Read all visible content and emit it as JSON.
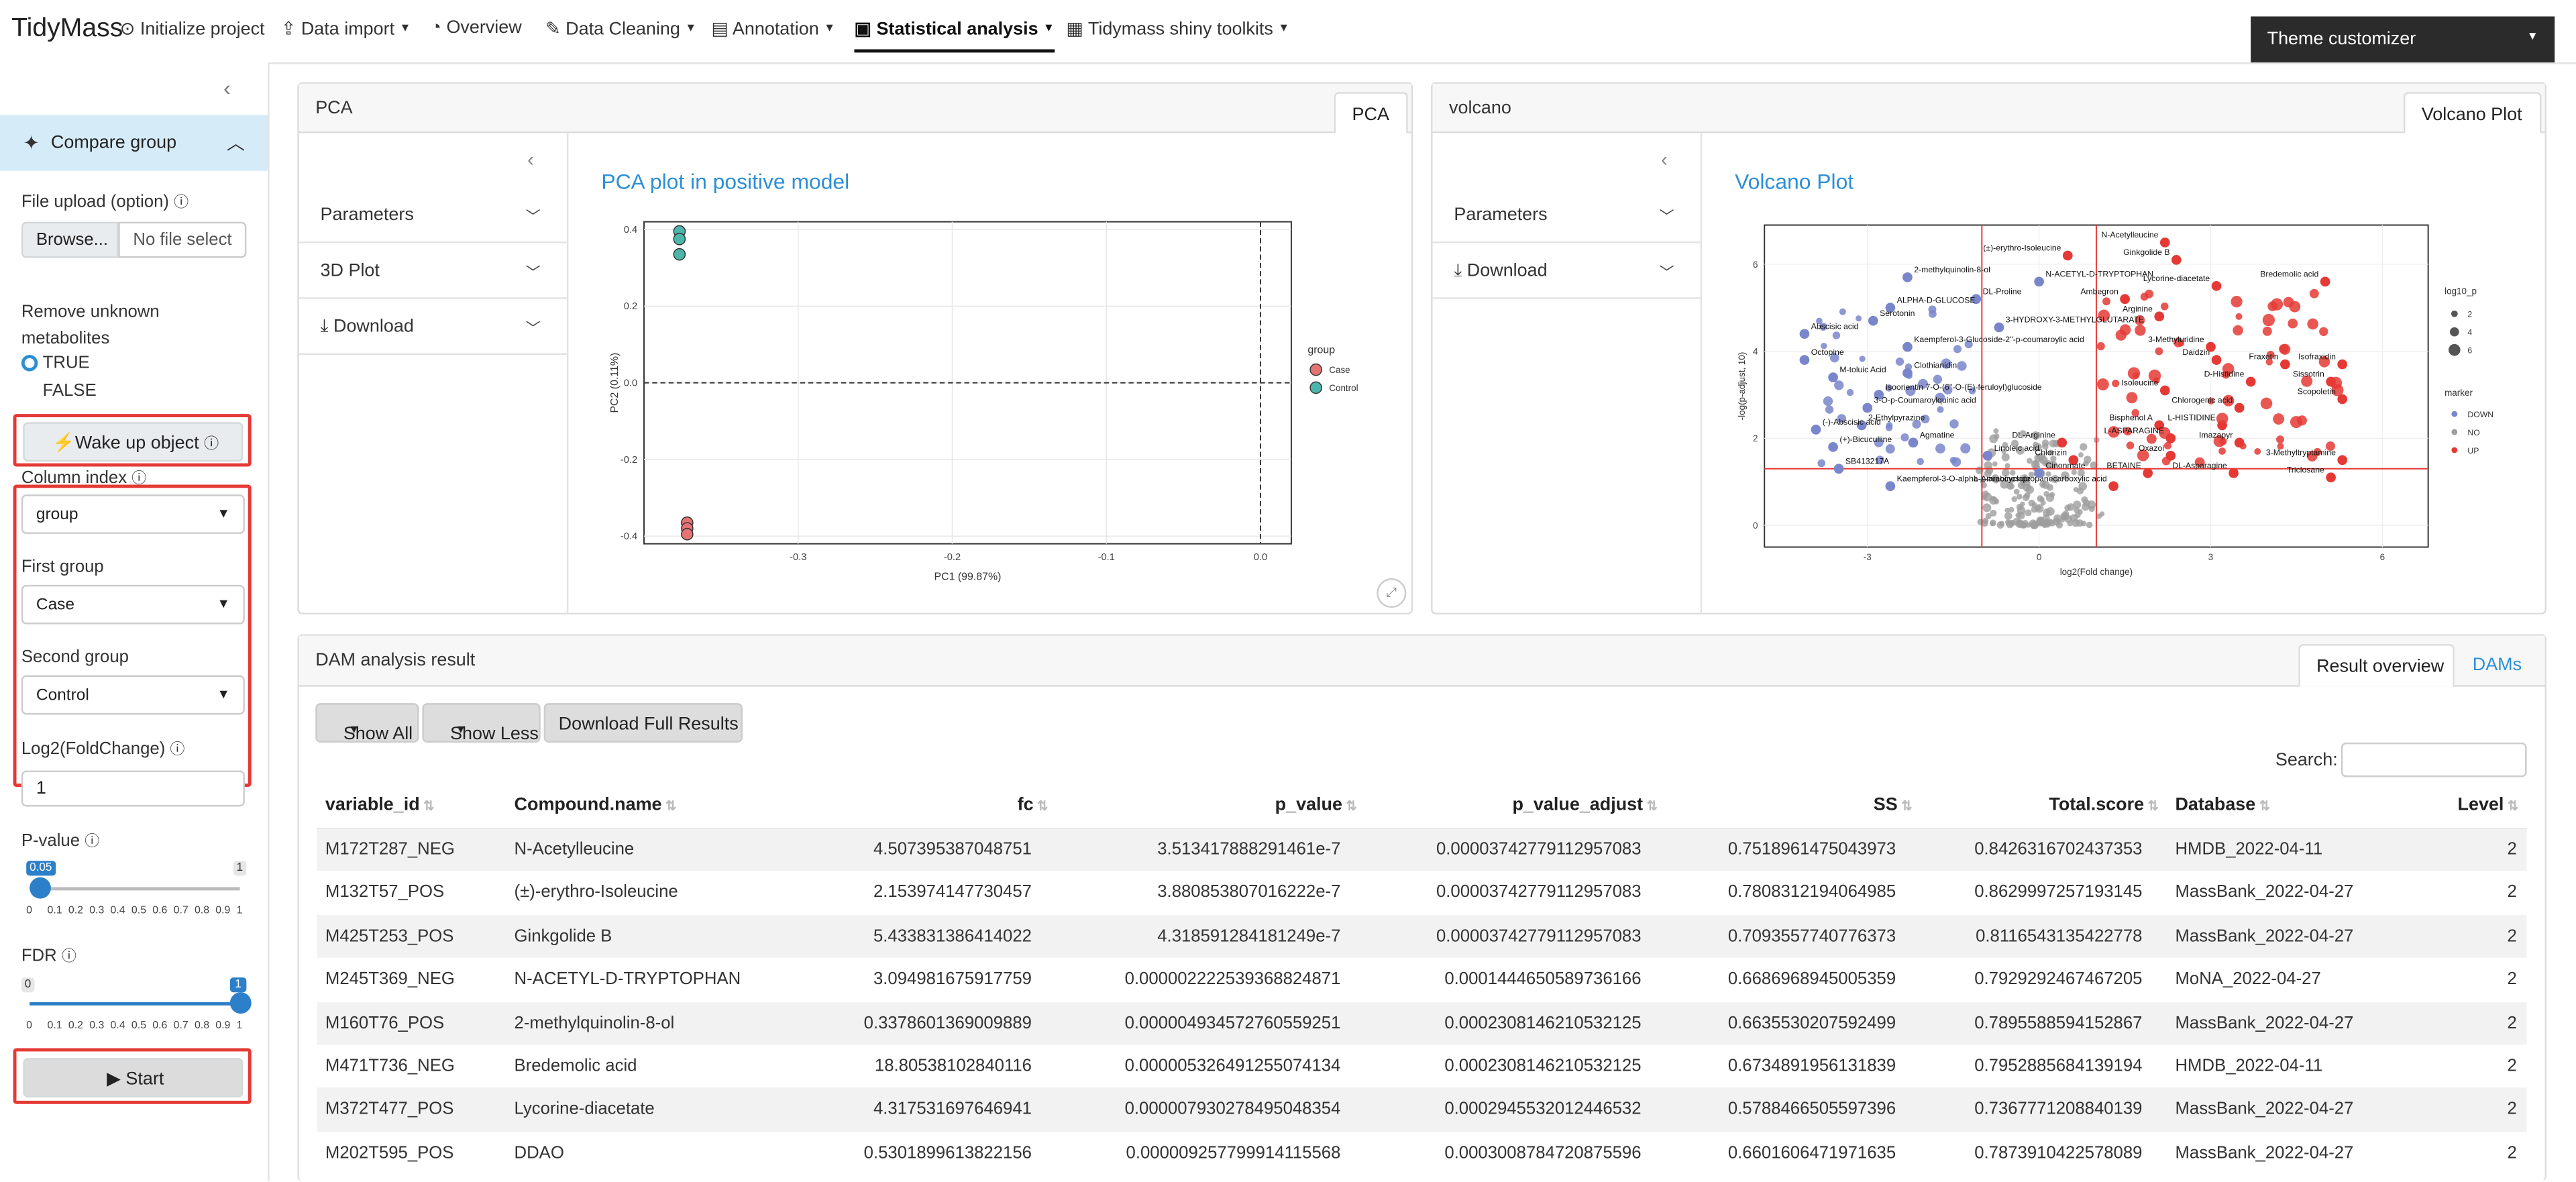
{
  "navbar": {
    "brand": "TidyMass",
    "items": [
      {
        "label": "Initialize project",
        "icon": "play-circle-icon"
      },
      {
        "label": "Data import",
        "icon": "upload-icon",
        "dropdown": true
      },
      {
        "label": "Overview",
        "icon": "gauge-icon"
      },
      {
        "label": "Data Cleaning",
        "icon": "broom-icon",
        "dropdown": true
      },
      {
        "label": "Annotation",
        "icon": "id-card-icon",
        "dropdown": true
      },
      {
        "label": "Statistical analysis",
        "icon": "chart-icon",
        "dropdown": true,
        "active": true
      },
      {
        "label": "Tidymass shiny toolkits",
        "icon": "toolbox-icon",
        "dropdown": true
      }
    ],
    "theme_button": "Theme customizer"
  },
  "sidebar": {
    "section_title": "Compare group",
    "file_upload_label": "File upload (option)",
    "browse_label": "Browse...",
    "file_placeholder": "No file select",
    "remove_unknown_label": "Remove unknown metabolites",
    "radio_true": "TRUE",
    "radio_false": "FALSE",
    "wake_up_label": "Wake up object",
    "column_index_label": "Column index",
    "column_index_value": "group",
    "first_group_label": "First group",
    "first_group_value": "Case",
    "second_group_label": "Second group",
    "second_group_value": "Control",
    "log2fc_label": "Log2(FoldChange)",
    "log2fc_value": "1",
    "pvalue_label": "P-value",
    "pvalue_value": 0.05,
    "pvalue_value_text": "0.05",
    "pvalue_max_text": "1",
    "fdr_label": "FDR",
    "fdr_value": 1,
    "fdr_value_text": "1",
    "fdr_min_text": "0",
    "slider_ticks": [
      "0",
      "0.1",
      "0.2",
      "0.3",
      "0.4",
      "0.5",
      "0.6",
      "0.7",
      "0.8",
      "0.9",
      "1"
    ],
    "start_label": "Start"
  },
  "pca_card": {
    "header": "PCA",
    "tab": "PCA",
    "accordion": [
      "Parameters",
      "3D Plot",
      "Download"
    ],
    "plot_title": "PCA plot in positive model"
  },
  "volcano_card": {
    "header": "volcano",
    "tab": "Volcano Plot",
    "accordion": [
      "Parameters",
      "Download"
    ],
    "plot_title": "Volcano Plot"
  },
  "chart_data": [
    {
      "type": "scatter",
      "title": "",
      "xlabel": "PC1 (99.87%)",
      "ylabel": "PC2 (0.11%)",
      "xlim": [
        -0.4,
        0.02
      ],
      "ylim": [
        -0.42,
        0.42
      ],
      "x_ticks": [
        "-0.3",
        "-0.2",
        "-0.1",
        "0.0"
      ],
      "y_ticks": [
        "0.4",
        "0.2",
        "0.0",
        "-0.2",
        "-0.4"
      ],
      "grid": true,
      "legend": {
        "title": "group",
        "position": "right",
        "entries": [
          "Case",
          "Control"
        ]
      },
      "series": [
        {
          "name": "Case",
          "color": "#e57373",
          "points": [
            [
              -0.372,
              -0.365
            ],
            [
              -0.372,
              -0.38
            ],
            [
              -0.372,
              -0.395
            ]
          ]
        },
        {
          "name": "Control",
          "color": "#4db6ac",
          "points": [
            [
              -0.377,
              0.395
            ],
            [
              -0.377,
              0.375
            ],
            [
              -0.377,
              0.335
            ]
          ]
        }
      ]
    },
    {
      "type": "scatter",
      "title": "",
      "xlabel": "log2(Fold change)",
      "ylabel": "-log(p-adjust, 10)",
      "xlim": [
        -4.8,
        6.8
      ],
      "ylim": [
        -0.5,
        6.9
      ],
      "x_ticks": [
        "-3",
        "0",
        "3",
        "6"
      ],
      "y_ticks": [
        "0",
        "2",
        "4",
        "6"
      ],
      "thresholds": {
        "fc": [
          -1,
          1
        ],
        "p": 1.3
      },
      "legend": {
        "size_title": "log10_p",
        "size_entries": [
          "2",
          "4",
          "6"
        ],
        "marker_title": "marker",
        "marker_entries": [
          "DOWN",
          "NO",
          "UP"
        ],
        "position": "right"
      },
      "colors": {
        "UP": "#e53935",
        "DOWN": "#7986cb",
        "NO": "#9e9e9e"
      },
      "labels": [
        {
          "text": "N-Acetylleucine",
          "x": 2.2,
          "y": 6.5
        },
        {
          "text": "(±)-erythro-Isoleucine",
          "x": 0.5,
          "y": 6.2
        },
        {
          "text": "Ginkgolide B",
          "x": 2.4,
          "y": 6.1
        },
        {
          "text": "2-methylquinolin-8-ol",
          "x": -2.3,
          "y": 5.7
        },
        {
          "text": "N-ACETYL-D-TRYPTOPHAN",
          "x": 0.0,
          "y": 5.6
        },
        {
          "text": "Lycorine-diacetate",
          "x": 3.1,
          "y": 5.5
        },
        {
          "text": "Bredemolic acid",
          "x": 5.0,
          "y": 5.6
        },
        {
          "text": "DL-Proline",
          "x": -1.1,
          "y": 5.2
        },
        {
          "text": "Ambegron",
          "x": 1.5,
          "y": 5.2
        },
        {
          "text": "ALPHA-D-GLUCOSE",
          "x": -2.6,
          "y": 5.0
        },
        {
          "text": "Arginine",
          "x": 2.1,
          "y": 4.8
        },
        {
          "text": "Serotonin",
          "x": -2.9,
          "y": 4.7
        },
        {
          "text": "3-HYDROXY-3-METHYLGLUTARATE",
          "x": -0.7,
          "y": 4.55
        },
        {
          "text": "Abscisic acid",
          "x": -4.1,
          "y": 4.4
        },
        {
          "text": "Octopine",
          "x": -4.1,
          "y": 3.8
        },
        {
          "text": "M-toluic Acid",
          "x": -3.6,
          "y": 3.4
        },
        {
          "text": "Kaempferol-3-Glucoside-2''-p-coumaroylic acid",
          "x": -2.3,
          "y": 4.1
        },
        {
          "text": "Clothianidin",
          "x": -2.3,
          "y": 3.5
        },
        {
          "text": "Isoorientin 7-O-(6''-O-(E)-feruloyl)glucoside",
          "x": -2.8,
          "y": 3.0
        },
        {
          "text": "3-O-p-Coumaroylquinic acid",
          "x": -3.0,
          "y": 2.7
        },
        {
          "text": "2-Ethylpyrazine",
          "x": -3.1,
          "y": 2.3
        },
        {
          "text": "(-)-Abscisic acid",
          "x": -3.9,
          "y": 2.2
        },
        {
          "text": "(+)-Bicuculline",
          "x": -3.6,
          "y": 1.8
        },
        {
          "text": "Agmatine",
          "x": -2.2,
          "y": 1.9
        },
        {
          "text": "SB413217A",
          "x": -3.5,
          "y": 1.3
        },
        {
          "text": "Kaempferol-3-O-alpha-L-arabinoside",
          "x": -2.6,
          "y": 0.9
        },
        {
          "text": "Linoleic acid",
          "x": -0.9,
          "y": 1.6
        },
        {
          "text": "Chlorogenic acid",
          "x": 3.5,
          "y": 2.7
        },
        {
          "text": "Scopoletin",
          "x": 5.3,
          "y": 2.9
        },
        {
          "text": "Isofraxidin",
          "x": 5.3,
          "y": 3.7
        },
        {
          "text": "Sissotrin",
          "x": 5.1,
          "y": 3.3
        },
        {
          "text": "Fraxetin",
          "x": 4.3,
          "y": 3.7
        },
        {
          "text": "Daidzin",
          "x": 3.1,
          "y": 3.8
        },
        {
          "text": "3-Methyluridine",
          "x": 3.0,
          "y": 4.1
        },
        {
          "text": "D-Histidine",
          "x": 3.7,
          "y": 3.3
        },
        {
          "text": "Isoleucine",
          "x": 2.2,
          "y": 3.1
        },
        {
          "text": "Bisphenol A",
          "x": 2.1,
          "y": 2.3
        },
        {
          "text": "L-HISTIDINE",
          "x": 3.2,
          "y": 2.3
        },
        {
          "text": "L-ASPARAGINE",
          "x": 2.3,
          "y": 2.0
        },
        {
          "text": "Imazapyr",
          "x": 3.5,
          "y": 1.9
        },
        {
          "text": "Oxazol",
          "x": 2.3,
          "y": 1.6
        },
        {
          "text": "DL-Asparagine",
          "x": 3.4,
          "y": 1.2
        },
        {
          "text": "3-Methyltryptamine",
          "x": 5.3,
          "y": 1.5
        },
        {
          "text": "Triclosane",
          "x": 5.1,
          "y": 1.1
        },
        {
          "text": "BETAINE",
          "x": 1.9,
          "y": 1.2
        },
        {
          "text": "Chlorizin",
          "x": 0.6,
          "y": 1.5
        },
        {
          "text": "L-Aminocyclopropanecarboxylic acid",
          "x": 1.3,
          "y": 0.9
        },
        {
          "text": "DL-Arginine",
          "x": 0.4,
          "y": 1.9
        },
        {
          "text": "Cinonmate",
          "x": 0.0,
          "y": 1.2
        }
      ],
      "points_note": "many unlabeled grey NO points clustered around x 0, y 0-2"
    }
  ],
  "dam_card": {
    "header": "DAM analysis result",
    "tabs": [
      "Result overview",
      "DAMs"
    ],
    "buttons": [
      "Show All",
      "Show Less",
      "Download Full Results"
    ],
    "search_label": "Search:",
    "columns": [
      "variable_id",
      "Compound.name",
      "fc",
      "p_value",
      "p_value_adjust",
      "SS",
      "Total.score",
      "Database",
      "Level"
    ],
    "rows": [
      [
        "M172T287_NEG",
        "N-Acetylleucine",
        "4.507395387048751",
        "3.513417888291461e-7",
        "0.00003742779112957083",
        "0.7518961475043973",
        "0.8426316702437353",
        "HMDB_2022-04-11",
        "2"
      ],
      [
        "M132T57_POS",
        "(±)-erythro-Isoleucine",
        "2.153974147730457",
        "3.880853807016222e-7",
        "0.00003742779112957083",
        "0.7808312194064985",
        "0.8629997257193145",
        "MassBank_2022-04-27",
        "2"
      ],
      [
        "M425T253_POS",
        "Ginkgolide B",
        "5.433831386414022",
        "4.318591284181249e-7",
        "0.00003742779112957083",
        "0.7093557740776373",
        "0.8116543135422778",
        "MassBank_2022-04-27",
        "2"
      ],
      [
        "M245T369_NEG",
        "N-ACETYL-D-TRYPTOPHAN",
        "3.094981675917759",
        "0.000002222539368824871",
        "0.0001444650589736166",
        "0.6686968945005359",
        "0.7929292467467205",
        "MoNA_2022-04-27",
        "2"
      ],
      [
        "M160T76_POS",
        "2-methylquinolin-8-ol",
        "0.3378601369009889",
        "0.000004934572760559251",
        "0.0002308146210532125",
        "0.6635530207592499",
        "0.7895588594152867",
        "MassBank_2022-04-27",
        "2"
      ],
      [
        "M471T736_NEG",
        "Bredemolic acid",
        "18.80538102840116",
        "0.000005326491255074134",
        "0.0002308146210532125",
        "0.6734891956131839",
        "0.7952885684139194",
        "HMDB_2022-04-11",
        "2"
      ],
      [
        "M372T477_POS",
        "Lycorine-diacetate",
        "4.317531697646941",
        "0.000007930278495048354",
        "0.0002945532012446532",
        "0.5788466505597396",
        "0.7367771208840139",
        "MassBank_2022-04-27",
        "2"
      ],
      [
        "M202T595_POS",
        "DDAO",
        "0.5301899613822156",
        "0.000009257799914115568",
        "0.0003008784720875596",
        "0.6601606471971635",
        "0.7873910422578089",
        "MassBank_2022-04-27",
        "2"
      ]
    ]
  }
}
